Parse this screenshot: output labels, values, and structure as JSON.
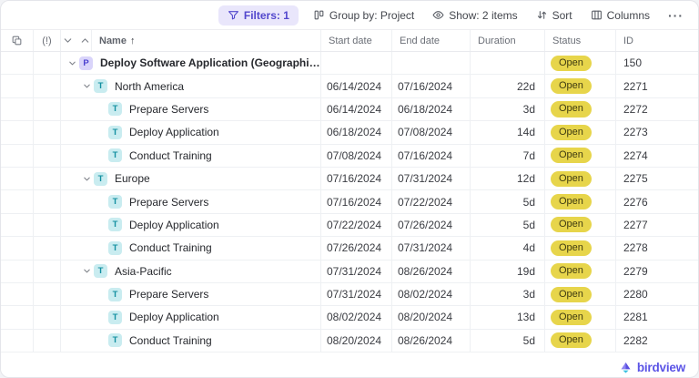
{
  "toolbar": {
    "filters_label": "Filters: 1",
    "group_by_label": "Group by: Project",
    "show_label": "Show: 2 items",
    "sort_label": "Sort",
    "columns_label": "Columns",
    "more_label": "···"
  },
  "icons": {
    "filter-icon": "funnel",
    "group-by-icon": "kanban-board",
    "show-icon": "eye",
    "sort-icon": "arrows-up-down",
    "columns-icon": "table-columns",
    "more-icon": "ellipsis",
    "copy-icon": "overlapping-squares",
    "alert-icon": "(!)",
    "collapse-all-icon": "chevron-down",
    "expand-all-icon": "chevron-up",
    "row-expand-icon": "chevron-down",
    "brand-icon": "birdview-mark"
  },
  "table": {
    "header": {
      "alert": "(!)",
      "name": "Name",
      "sort_arrow": "↑",
      "start": "Start date",
      "end": "End date",
      "duration": "Duration",
      "status": "Status",
      "id": "ID"
    },
    "rows": [
      {
        "level": 0,
        "icon": "P",
        "expandable": true,
        "bold": true,
        "name": "Deploy Software Application (Geographical WBS)",
        "start": "",
        "end": "",
        "duration": "",
        "status": "Open",
        "id": "150"
      },
      {
        "level": 1,
        "icon": "T",
        "expandable": true,
        "bold": false,
        "name": "North America",
        "start": "06/14/2024",
        "end": "07/16/2024",
        "duration": "22d",
        "status": "Open",
        "id": "2271"
      },
      {
        "level": 2,
        "icon": "T",
        "expandable": false,
        "bold": false,
        "name": "Prepare Servers",
        "start": "06/14/2024",
        "end": "06/18/2024",
        "duration": "3d",
        "status": "Open",
        "id": "2272"
      },
      {
        "level": 2,
        "icon": "T",
        "expandable": false,
        "bold": false,
        "name": "Deploy Application",
        "start": "06/18/2024",
        "end": "07/08/2024",
        "duration": "14d",
        "status": "Open",
        "id": "2273"
      },
      {
        "level": 2,
        "icon": "T",
        "expandable": false,
        "bold": false,
        "name": "Conduct Training",
        "start": "07/08/2024",
        "end": "07/16/2024",
        "duration": "7d",
        "status": "Open",
        "id": "2274"
      },
      {
        "level": 1,
        "icon": "T",
        "expandable": true,
        "bold": false,
        "name": "Europe",
        "start": "07/16/2024",
        "end": "07/31/2024",
        "duration": "12d",
        "status": "Open",
        "id": "2275"
      },
      {
        "level": 2,
        "icon": "T",
        "expandable": false,
        "bold": false,
        "name": "Prepare Servers",
        "start": "07/16/2024",
        "end": "07/22/2024",
        "duration": "5d",
        "status": "Open",
        "id": "2276"
      },
      {
        "level": 2,
        "icon": "T",
        "expandable": false,
        "bold": false,
        "name": "Deploy Application",
        "start": "07/22/2024",
        "end": "07/26/2024",
        "duration": "5d",
        "status": "Open",
        "id": "2277"
      },
      {
        "level": 2,
        "icon": "T",
        "expandable": false,
        "bold": false,
        "name": "Conduct Training",
        "start": "07/26/2024",
        "end": "07/31/2024",
        "duration": "4d",
        "status": "Open",
        "id": "2278"
      },
      {
        "level": 1,
        "icon": "T",
        "expandable": true,
        "bold": false,
        "name": "Asia-Pacific",
        "start": "07/31/2024",
        "end": "08/26/2024",
        "duration": "19d",
        "status": "Open",
        "id": "2279"
      },
      {
        "level": 2,
        "icon": "T",
        "expandable": false,
        "bold": false,
        "name": "Prepare Servers",
        "start": "07/31/2024",
        "end": "08/02/2024",
        "duration": "3d",
        "status": "Open",
        "id": "2280"
      },
      {
        "level": 2,
        "icon": "T",
        "expandable": false,
        "bold": false,
        "name": "Deploy Application",
        "start": "08/02/2024",
        "end": "08/20/2024",
        "duration": "13d",
        "status": "Open",
        "id": "2281"
      },
      {
        "level": 2,
        "icon": "T",
        "expandable": false,
        "bold": false,
        "name": "Conduct Training",
        "start": "08/20/2024",
        "end": "08/26/2024",
        "duration": "5d",
        "status": "Open",
        "id": "2282"
      }
    ]
  },
  "footer": {
    "brand": "birdview"
  },
  "colors": {
    "accent_purple": "#5348cd",
    "filters_pill_bg": "#e9e6fb",
    "status_badge_bg": "#e7d54b",
    "status_badge_text": "#3f3b11",
    "project_badge_bg": "#d9d4fa",
    "project_badge_text": "#4a3fd0",
    "task_badge_bg": "#c9ecf0",
    "task_badge_text": "#128fa0",
    "brand_purple": "#5b54e6"
  }
}
